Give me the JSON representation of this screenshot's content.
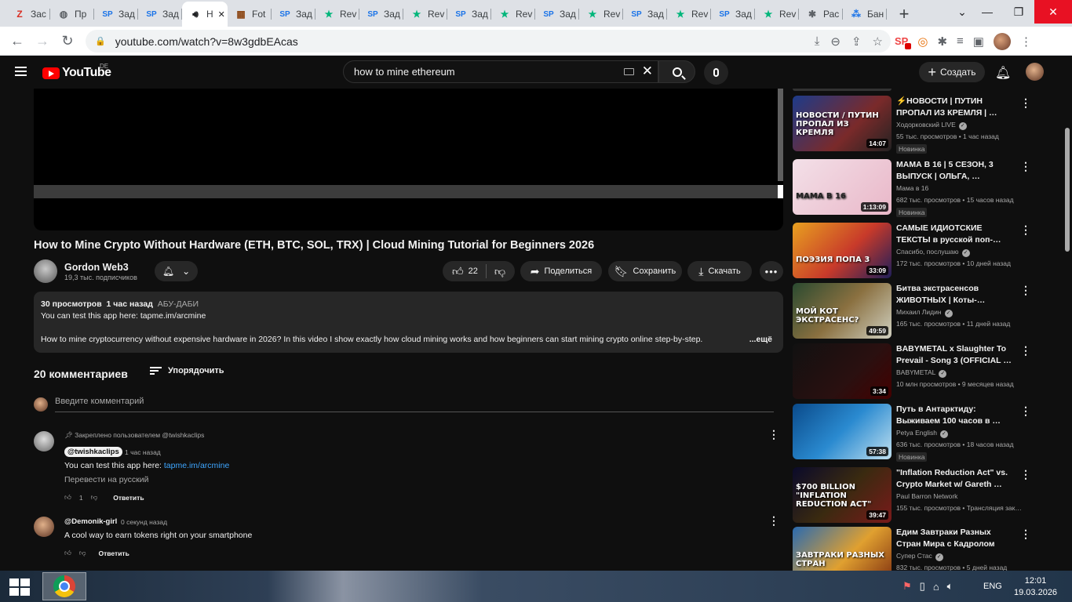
{
  "browser": {
    "tabs": [
      {
        "icon": "Z",
        "label": "Зас",
        "color": "#d93025"
      },
      {
        "icon": "globe",
        "label": "Пр",
        "color": "#5f6368"
      },
      {
        "icon": "SP",
        "label": "Зад",
        "color": "#1a73e8"
      },
      {
        "icon": "SP",
        "label": "Зад",
        "color": "#1a73e8"
      },
      {
        "icon": "speaker",
        "label": "H",
        "color": "#202124",
        "active": true
      },
      {
        "icon": "photo",
        "label": "Fot",
        "color": "#8b4513"
      },
      {
        "icon": "SP",
        "label": "Зад",
        "color": "#1a73e8"
      },
      {
        "icon": "★",
        "label": "Rev",
        "color": "#00b67a"
      },
      {
        "icon": "SP",
        "label": "Зад",
        "color": "#1a73e8"
      },
      {
        "icon": "★",
        "label": "Rev",
        "color": "#00b67a"
      },
      {
        "icon": "SP",
        "label": "Зад",
        "color": "#1a73e8"
      },
      {
        "icon": "★",
        "label": "Rev",
        "color": "#00b67a"
      },
      {
        "icon": "SP",
        "label": "Зад",
        "color": "#1a73e8"
      },
      {
        "icon": "★",
        "label": "Rev",
        "color": "#00b67a"
      },
      {
        "icon": "SP",
        "label": "Зад",
        "color": "#1a73e8"
      },
      {
        "icon": "★",
        "label": "Rev",
        "color": "#00b67a"
      },
      {
        "icon": "SP",
        "label": "Зад",
        "color": "#1a73e8"
      },
      {
        "icon": "★",
        "label": "Rev",
        "color": "#00b67a"
      },
      {
        "icon": "puzzle",
        "label": "Рас",
        "color": "#5f6368"
      },
      {
        "icon": "bubbles",
        "label": "Бан",
        "color": "#1a73e8"
      }
    ],
    "url": "youtube.com/watch?v=8w3gdbEAcas"
  },
  "yt": {
    "logo_text": "YouTube",
    "country": "DE",
    "search_value": "how to mine ethereum",
    "create_label": "Создать"
  },
  "video": {
    "title": "How to Mine Crypto Without Hardware (ETH, BTC, SOL, TRX) | Cloud Mining Tutorial for Beginners 2026",
    "channel": "Gordon Web3",
    "subscribers": "19,3 тыс. подписчиков",
    "likes": "22",
    "share_label": "Поделиться",
    "save_label": "Сохранить",
    "download_label": "Скачать",
    "views": "30 просмотров",
    "age": "1 час назад",
    "location": "АБУ-ДАБИ",
    "desc_line1": "You can test this app here: tapme.im/arcmine",
    "desc_line2": "How to mine cryptocurrency without expensive hardware in 2026? In this video I show exactly how cloud mining works and how beginners can start mining crypto online step-by-step.",
    "more_label": "...ещё"
  },
  "comments": {
    "count_label": "20 комментариев",
    "sort_label": "Упорядочить",
    "placeholder": "Введите комментарий",
    "items": [
      {
        "pinned": "Закреплено пользователем @twishkaclips",
        "author": "@twishkaclips",
        "time": "1 час назад",
        "text": "You can test this app here: ",
        "link": "tapme.im/arcmine",
        "translate": "Перевести на русский",
        "likes": "1",
        "reply": "Ответить"
      },
      {
        "author": "@Demonik-girl",
        "time": "0 секунд назад",
        "text": "A cool way to earn tokens right on your smartphone",
        "reply": "Ответить"
      }
    ]
  },
  "sidebar": [
    {
      "title": "⚡НОВОСТИ | ПУТИН ПРОПАЛ ИЗ КРЕМЛЯ | …",
      "channel": "Ходорковский LIVE",
      "verified": true,
      "meta": "55 тыс. просмотров • 1 час назад",
      "badge": "Новинка",
      "duration": "14:07",
      "thumb_text": "НОВОСТИ / ПУТИН ПРОПАЛ ИЗ КРЕМЛЯ"
    },
    {
      "title": "МАМА В 16 | 5 СЕЗОН, 3 ВЫПУСК | ОЛЬГА, …",
      "channel": "Мама в 16",
      "verified": false,
      "meta": "682 тыс. просмотров • 15 часов назад",
      "badge": "Новинка",
      "duration": "1:13:09",
      "thumb_text": "МАМА В 16"
    },
    {
      "title": "САМЫЕ ИДИОТСКИЕ ТЕКСТЫ в русской поп-…",
      "channel": "Спасибо, послушаю",
      "verified": true,
      "meta": "172 тыс. просмотров • 10 дней назад",
      "badge": "",
      "duration": "33:09",
      "thumb_text": "ПОЭЗИЯ ПОПА 3"
    },
    {
      "title": "Битва экстрасенсов ЖИВОТНЫХ | Коты-…",
      "channel": "Михаил Лидин",
      "verified": true,
      "meta": "165 тыс. просмотров • 11 дней назад",
      "badge": "",
      "duration": "49:59",
      "thumb_text": "МОЙ КОТ ЭКСТРАСЕНС?"
    },
    {
      "title": "BABYMETAL x Slaughter To Prevail - Song 3 (OFFICIAL …",
      "channel": "BABYMETAL",
      "verified": true,
      "meta": "10 млн просмотров • 9 месяцев назад",
      "badge": "",
      "duration": "3:34",
      "thumb_text": ""
    },
    {
      "title": "Путь в Антарктиду: Выживаем 100 часов в …",
      "channel": "Petya English",
      "verified": true,
      "meta": "636 тыс. просмотров • 18 часов назад",
      "badge": "Новинка",
      "duration": "57:38",
      "thumb_text": ""
    },
    {
      "title": "\"Inflation Reduction Act\" vs. Crypto Market w/ Gareth …",
      "channel": "Paul Barron Network",
      "verified": false,
      "meta": "155 тыс. просмотров • Трансляция зак…",
      "badge": "",
      "duration": "39:47",
      "thumb_text": "$700 BILLION \"INFLATION REDUCTION ACT\""
    },
    {
      "title": "Едим Завтраки Разных Стран Мира с Кадролом",
      "channel": "Супер Стас",
      "verified": true,
      "meta": "832 тыс. просмотров • 5 дней назад",
      "badge": "",
      "duration": "",
      "thumb_text": "ЗАВТРАКИ РАЗНЫХ СТРАН"
    }
  ],
  "taskbar": {
    "lang": "ENG",
    "time": "12:01",
    "date": "19.03.2026"
  },
  "colors": {
    "accent": "#3ea6ff",
    "yt_red": "#ff0000",
    "bg": "#0f0f0f"
  }
}
